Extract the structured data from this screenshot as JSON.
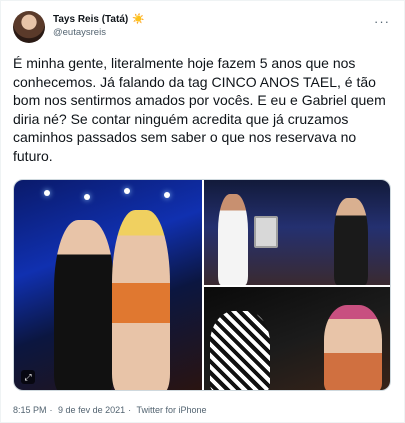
{
  "author": {
    "display_name": "Tays Reis (Tatá)",
    "emoji": "☀️",
    "handle": "@eutaysreis"
  },
  "more_icon": "more-horizontal-icon",
  "tweet": {
    "text": "É minha gente, literalmente hoje fazem 5 anos que nos conhecemos. Já falando da tag CINCO ANOS TAEL, é tão bom nos sentirmos amados por vocês. E eu e Gabriel quem diria né? Se contar ninguém acredita que já cruzamos caminhos passados sem saber o que nos reservava no futuro."
  },
  "footer": {
    "time": "8:15 PM",
    "date": "9 de fev de 2021",
    "source": "Twitter for iPhone",
    "separator": "·"
  },
  "colors": {
    "text": "#0f1419",
    "secondary": "#536471",
    "border": "#cfd9de"
  }
}
